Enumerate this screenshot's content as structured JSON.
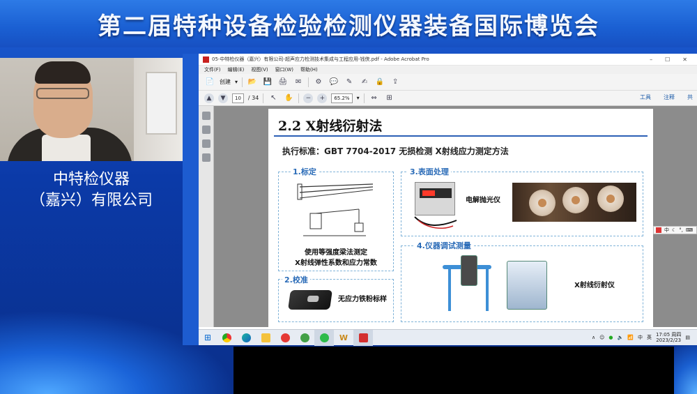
{
  "event": {
    "title": "第二届特种设备检验检测仪器装备国际博览会"
  },
  "presenter": {
    "company_line1": "中特检仪器",
    "company_line2": "（嘉兴）有限公司"
  },
  "acrobat": {
    "window_title": "05-中特检仪器（嘉兴）有限公司-超声应力检测技术集成与工程应用-钱侠.pdf - Adobe Acrobat Pro",
    "menu": [
      "文件(F)",
      "编辑(E)",
      "视图(V)",
      "窗口(W)",
      "帮助(H)"
    ],
    "create_label": "创建",
    "page_current": "10",
    "page_total": "/ 34",
    "zoom": "65.2%",
    "right_tools": [
      "工具",
      "注释",
      "共"
    ]
  },
  "slide": {
    "title": "2.2 X射线衍射法",
    "standard": "执行标准：GBT 7704-2017 无损检测 X射线应力测定方法",
    "panels": {
      "calibration": {
        "heading": "1.标定",
        "caption_line1": "使用等强度梁法测定",
        "caption_line2": "X射线弹性系数和应力常数"
      },
      "verification": {
        "heading": "2.校准",
        "caption": "无应力铁粉标样"
      },
      "surface": {
        "heading": "3.表面处理",
        "caption": "电解抛光仪"
      },
      "measurement": {
        "heading": "4.仪器调试测量",
        "caption": "X射线衍射仪"
      }
    }
  },
  "taskbar": {
    "ime": "中",
    "tray_ime": "中",
    "time": "17:05 周四",
    "date": "2023/2/23"
  },
  "ime_float": {
    "label": "中"
  }
}
